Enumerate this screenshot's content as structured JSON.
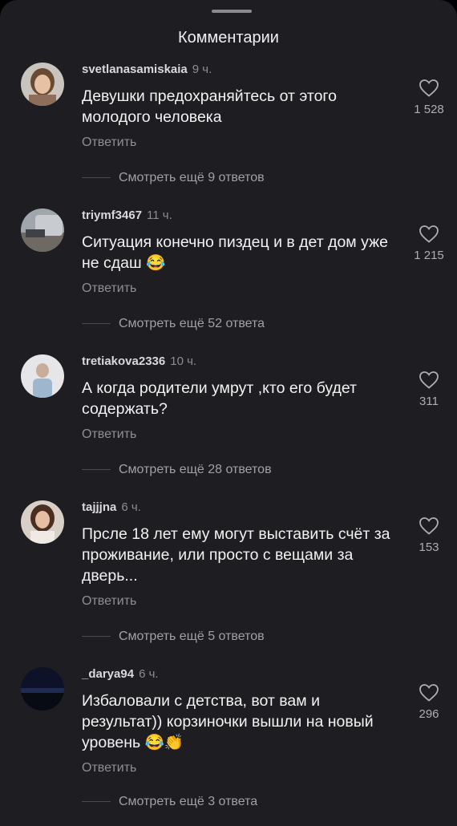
{
  "sheet": {
    "title": "Комментарии"
  },
  "comments": [
    {
      "username": "svetlanasamiskaia",
      "time": "9 ч.",
      "text": "Девушки предохраняйтесь от этого молодого человека",
      "reply_label": "Ответить",
      "likes": "1 528",
      "more_replies": "Смотреть ещё 9 ответов",
      "avatar_icon": "user-avatar-icon"
    },
    {
      "username": "triymf3467",
      "time": "11 ч.",
      "text": "Ситуация конечно пиздец и в дет дом уже не сдаш",
      "emoji": "😂",
      "reply_label": "Ответить",
      "likes": "1 215",
      "more_replies": "Смотреть ещё 52 ответа",
      "avatar_icon": "user-avatar-icon"
    },
    {
      "username": "tretiakova2336",
      "time": "10 ч.",
      "text": "А когда родители умрут ,кто его будет содержать?",
      "reply_label": "Ответить",
      "likes": "311",
      "more_replies": "Смотреть ещё 28 ответов",
      "avatar_icon": "user-avatar-icon"
    },
    {
      "username": "tajjjna",
      "time": "6 ч.",
      "text": "Прсле 18 лет ему могут выставить счёт за проживание, или просто с вещами за дверь...",
      "reply_label": "Ответить",
      "likes": "153",
      "more_replies": "Смотреть ещё 5 ответов",
      "avatar_icon": "user-avatar-icon"
    },
    {
      "username": "_darya94",
      "time": "6 ч.",
      "text": "Избаловали с детства, вот вам и результат)) корзиночки вышли на новый уровень",
      "emoji": "😂👏",
      "reply_label": "Ответить",
      "likes": "296",
      "more_replies": "Смотреть ещё 3 ответа",
      "avatar_icon": "user-avatar-icon"
    }
  ],
  "colors": {
    "background": "#1e1e22",
    "text": "#f2f2f2",
    "muted": "#8e8e93"
  }
}
